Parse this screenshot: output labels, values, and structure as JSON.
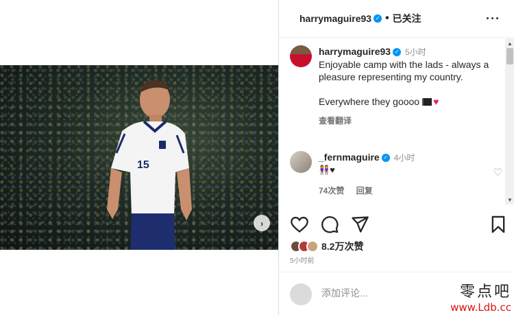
{
  "post": {
    "username": "harrymaguire93",
    "follow_label": "已关注",
    "separator": "•",
    "more_icon": "···"
  },
  "caption": {
    "username": "harrymaguire93",
    "time": "5小时",
    "line1": "Enjoyable camp with the lads - always a pleasure representing my country.",
    "line2": "Everywhere they goooo",
    "translate_label": "查看翻译"
  },
  "comment": {
    "username": "_fernmaguire",
    "time": "4小时",
    "text": "👭♥",
    "likes": "74次赞",
    "reply_label": "回复"
  },
  "actions": {
    "likes_count": "8.2万次赞",
    "posted_time": "5小时前"
  },
  "add_comment": {
    "placeholder": "添加评论..."
  },
  "carousel": {
    "next_glyph": "›",
    "slide_count": 4,
    "active_index": 0
  },
  "watermark": {
    "top": "零点吧",
    "bottom": "www.Ldb.cc"
  },
  "colors": {
    "accent": "#0095f6",
    "text": "#262626",
    "muted": "#8e8e8e",
    "heart": "#e0245e"
  }
}
